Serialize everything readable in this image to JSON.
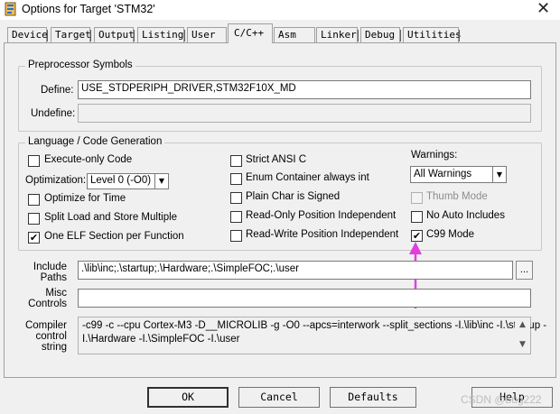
{
  "window": {
    "title": "Options for Target 'STM32'",
    "close_glyph": "✕"
  },
  "tabs": [
    {
      "label": "Device"
    },
    {
      "label": "Target"
    },
    {
      "label": "Output"
    },
    {
      "label": "Listing"
    },
    {
      "label": "User"
    },
    {
      "label": "C/C++"
    },
    {
      "label": "Asm"
    },
    {
      "label": "Linker"
    },
    {
      "label": "Debug"
    },
    {
      "label": "Utilities"
    }
  ],
  "active_tab": "C/C++",
  "preprocessor": {
    "group_title": "Preprocessor Symbols",
    "define_label": "Define:",
    "define_value": "USE_STDPERIPH_DRIVER,STM32F10X_MD",
    "undefine_label": "Undefine:",
    "undefine_value": ""
  },
  "language": {
    "group_title": "Language / Code Generation",
    "execute_only": {
      "label": "Execute-only Code",
      "checked": false
    },
    "optimization_label": "Optimization:",
    "optimization_value": "Level 0 (-O0)",
    "optimize_time": {
      "label": "Optimize for Time",
      "checked": false
    },
    "split_load": {
      "label": "Split Load and Store Multiple",
      "checked": false
    },
    "one_elf": {
      "label": "One ELF Section per Function",
      "checked": true
    },
    "strict_ansi": {
      "label": "Strict ANSI C",
      "checked": false
    },
    "enum_container": {
      "label": "Enum Container always int",
      "checked": false
    },
    "plain_char": {
      "label": "Plain Char is Signed",
      "checked": false
    },
    "read_only_pos": {
      "label": "Read-Only Position Independent",
      "checked": false
    },
    "read_write_pos": {
      "label": "Read-Write Position Independent",
      "checked": false
    },
    "warnings_label": "Warnings:",
    "warnings_value": "All Warnings",
    "thumb_mode": {
      "label": "Thumb Mode",
      "checked": false,
      "disabled": true
    },
    "no_auto_includes": {
      "label": "No Auto Includes",
      "checked": false
    },
    "c99_mode": {
      "label": "C99 Mode",
      "checked": true
    }
  },
  "include_paths": {
    "label_line1": "Include",
    "label_line2": "Paths",
    "value": ".\\lib\\inc;.\\startup;.\\Hardware;.\\SimpleFOC;.\\user",
    "browse_label": "..."
  },
  "misc_controls": {
    "label_line1": "Misc",
    "label_line2": "Controls",
    "value": ""
  },
  "compiler_control": {
    "label_line1": "Compiler",
    "label_line2": "control",
    "label_line3": "string",
    "line1": "-c99 -c --cpu Cortex-M3 -D__MICROLIB -g -O0 --apcs=interwork --split_sections -I.\\lib\\inc -I.\\startup -",
    "line2": "I.\\Hardware -I.\\SimpleFOC -I.\\user"
  },
  "buttons": {
    "ok": "OK",
    "cancel": "Cancel",
    "defaults": "Defaults",
    "help": "Help"
  },
  "watermark": "CSDN @bug222",
  "annotation_color": "#e040e0"
}
